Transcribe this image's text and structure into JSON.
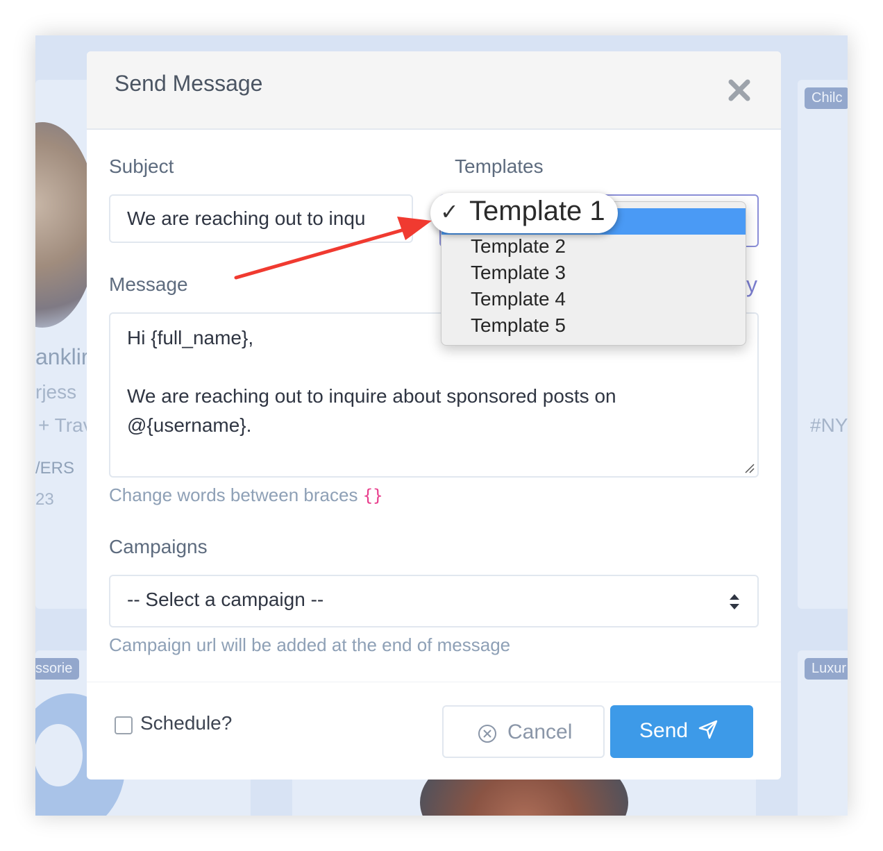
{
  "background": {
    "tags": [
      "Chilc",
      "ssorie",
      "Luxur"
    ],
    "texts": [
      "anklir",
      "rjess",
      "+ Trav",
      "/ERS",
      "23",
      "#NY"
    ]
  },
  "modal": {
    "title": "Send Message",
    "close_icon": "close-icon",
    "subject": {
      "label": "Subject",
      "value": "We are reaching out to inqu"
    },
    "templates": {
      "label": "Templates",
      "options": [
        "Template 1",
        "Template 2",
        "Template 3",
        "Template 4",
        "Template 5"
      ],
      "selected": "Template 1",
      "check_mark": "✓"
    },
    "message": {
      "label": "Message",
      "side_link_fragment": "y",
      "lines": [
        "Hi {full_name},",
        "",
        "We are reaching out to inquire about sponsored posts on",
        "@{username}.",
        ""
      ],
      "help_text": "Change words between braces",
      "help_braces": "{}"
    },
    "campaigns": {
      "label": "Campaigns",
      "placeholder": "-- Select a campaign --",
      "help_text": "Campaign url will be added at the end of message"
    },
    "footer": {
      "schedule_label": "Schedule?",
      "schedule_checked": false,
      "cancel_label": "Cancel",
      "send_label": "Send"
    }
  },
  "colors": {
    "accent": "#3d9ae8",
    "dropdown_highlight": "#4a9af5",
    "annotation_arrow": "#f03a30",
    "brace_color": "#e83e8c"
  }
}
